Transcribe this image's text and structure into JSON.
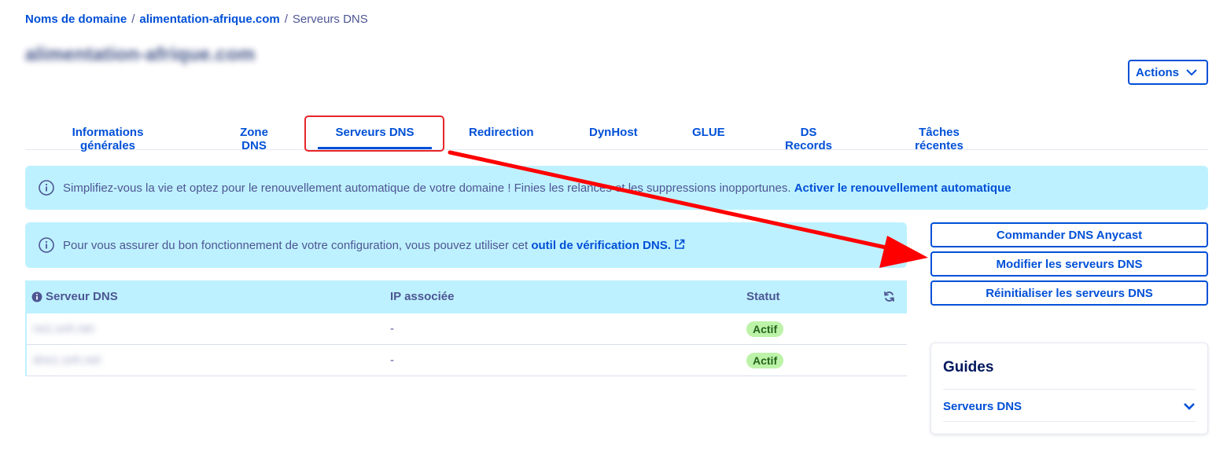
{
  "breadcrumb": {
    "item1": "Noms de domaine",
    "sep1": "/",
    "item2": "alimentation-afrique.com",
    "sep2": "/",
    "current": "Serveurs DNS"
  },
  "page_title": "alimentation-afrique.com",
  "actions_label": "Actions",
  "tabs": [
    {
      "label": "Informations générales"
    },
    {
      "label": "Zone DNS"
    },
    {
      "label": "Serveurs DNS",
      "active": true
    },
    {
      "label": "Redirection"
    },
    {
      "label": "DynHost"
    },
    {
      "label": "GLUE"
    },
    {
      "label": "DS Records"
    },
    {
      "label": "Tâches récentes"
    }
  ],
  "banner_renewal": {
    "text": "Simplifiez-vous la vie et optez pour le renouvellement automatique de votre domaine ! Finies les relances et les suppressions inopportunes.",
    "link": "Activer le renouvellement automatique"
  },
  "banner_check": {
    "text": "Pour vous assurer du bon fonctionnement de votre configuration, vous pouvez utiliser cet",
    "link": "outil de vérification DNS."
  },
  "side_buttons": {
    "order_anycast": "Commander DNS Anycast",
    "modify_servers": "Modifier les serveurs DNS",
    "reset_servers": "Réinitialiser les serveurs DNS"
  },
  "table": {
    "headers": {
      "server": "Serveur DNS",
      "ip": "IP associée",
      "status": "Statut"
    },
    "rows": [
      {
        "server": "ns1.ovh.net",
        "ip": "-",
        "status": "Actif"
      },
      {
        "server": "dns1.ovh.net",
        "ip": "-",
        "status": "Actif"
      }
    ]
  },
  "guides": {
    "title": "Guides",
    "item": "Serveurs DNS"
  },
  "colors": {
    "primary": "#0050d7",
    "banner_bg": "#bef1ff",
    "badge_bg": "#bcf3a8",
    "annotation_red": "#ff0000"
  }
}
